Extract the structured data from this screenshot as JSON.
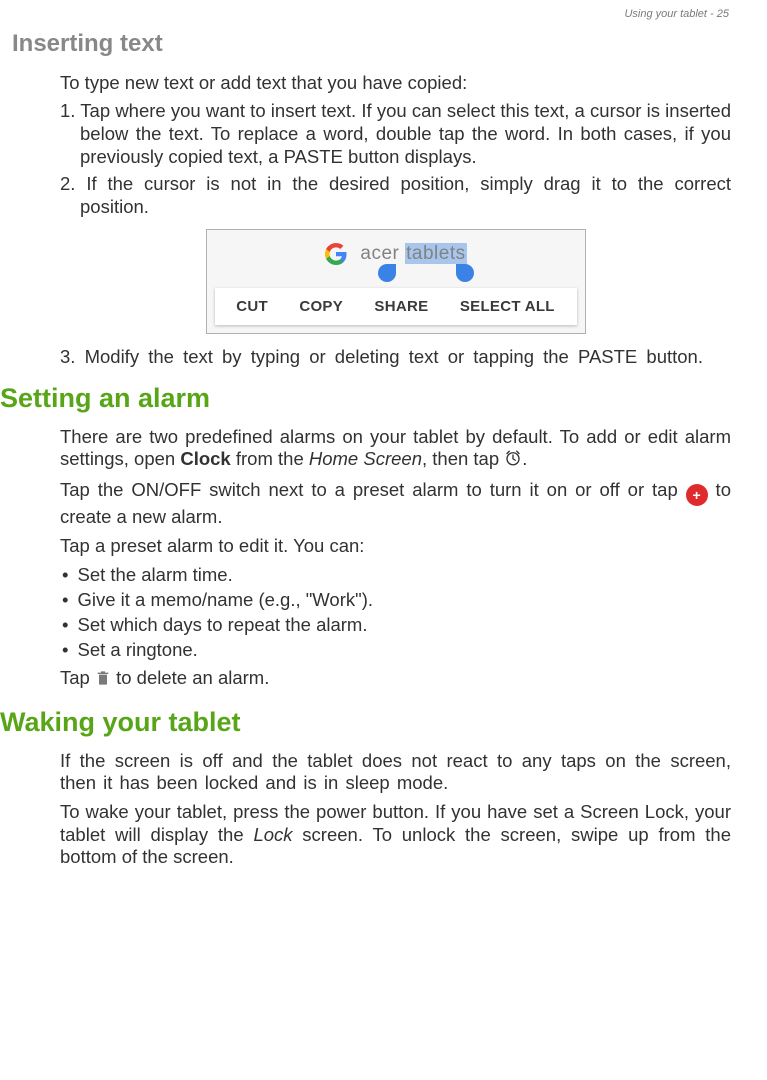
{
  "page_header": "Using your tablet - 25",
  "section_inserting_title": "Inserting text",
  "inserting_intro": "To type new text or add text that you have copied:",
  "inserting_steps": {
    "s1": "Tap where you want to insert text. If you can select this text, a cursor is inserted below the text. To replace a word, double tap the word. In both cases, if you previously copied text, a PASTE button displays.",
    "s2": "If the cursor is not in the desired position, simply drag it to the correct position.",
    "s3": "Modify the text by typing or deleting text or tapping the PASTE button."
  },
  "screenshot": {
    "search_prefix": "acer ",
    "search_selected": "tablets",
    "actions": {
      "cut": "CUT",
      "copy": "COPY",
      "share": "SHARE",
      "select_all": "SELECT ALL"
    }
  },
  "section_alarm_title": "Setting an alarm",
  "alarm": {
    "p1a": "There are two predefined alarms on your tablet by default. To add or edit alarm settings, open ",
    "p1_bold": "Clock",
    "p1b": " from the ",
    "p1_italic": "Home Screen",
    "p1c": ", then tap ",
    "p1d": ".",
    "p2a": "Tap the ON/OFF switch next to a preset alarm to turn it on or off or tap ",
    "p2b": " to create a new alarm.",
    "p3": "Tap a preset alarm to edit it. You can:",
    "bullets": {
      "b1": "Set the alarm time.",
      "b2": "Give it a memo/name (e.g., \"Work\").",
      "b3": "Set which days to repeat the alarm.",
      "b4": "Set a ringtone."
    },
    "p4a": "Tap ",
    "p4b": " to delete an alarm."
  },
  "section_waking_title": "Waking your tablet",
  "waking": {
    "p1": "If the screen is off and the tablet does not react to any taps on the screen, then it has been locked and is in sleep mode.",
    "p2a": "To wake your tablet, press the power button. If you have set a Screen Lock, your tablet will display the ",
    "p2_italic": "Lock",
    "p2b": " screen. To unlock the screen, swipe up from the bottom of the screen."
  },
  "icons": {
    "plus": "+"
  }
}
